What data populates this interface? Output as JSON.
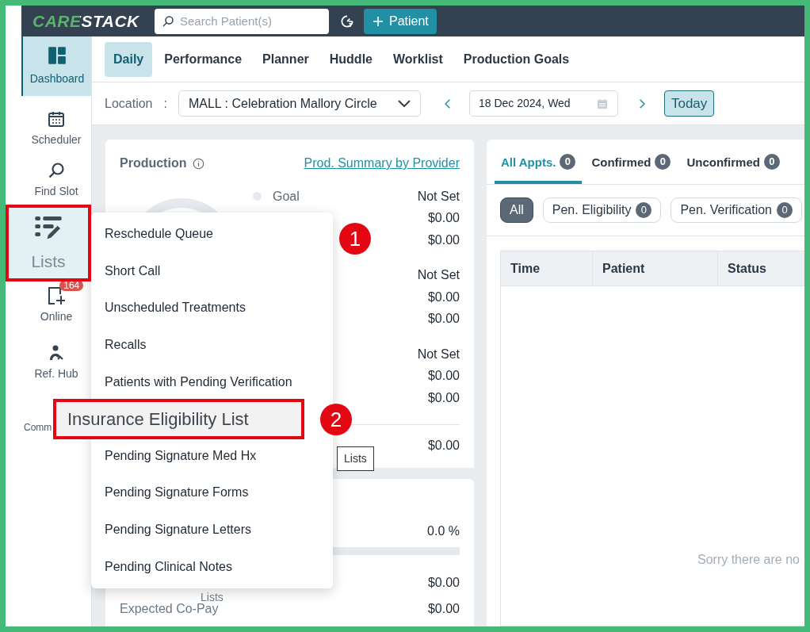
{
  "topbar": {
    "logo": "CARESTACK",
    "search": {
      "placeholder": "Search Patient(s)"
    },
    "add_button": "Patient"
  },
  "sidebar": {
    "items": [
      {
        "kind": "dashboard",
        "label": "Dashboard",
        "selected": true
      },
      {
        "kind": "calendar",
        "label": "Scheduler",
        "selected": false
      },
      {
        "kind": "search",
        "label": "Find Slot",
        "selected": false
      },
      {
        "kind": "lists",
        "label": "Lists",
        "selected": false,
        "callout": true
      },
      {
        "kind": "online",
        "label": "Online",
        "selected": false,
        "badge": "164"
      },
      {
        "kind": "refhub",
        "label": "Ref. Hub",
        "selected": false
      },
      {
        "kind": "comm",
        "label": "Comm",
        "selected": false,
        "clipped": true
      }
    ]
  },
  "tabs": [
    {
      "label": "Daily",
      "selected": true
    },
    {
      "label": "Performance",
      "selected": false
    },
    {
      "label": "Planner",
      "selected": false
    },
    {
      "label": "Huddle",
      "selected": false
    },
    {
      "label": "Worklist",
      "selected": false
    },
    {
      "label": "Production Goals",
      "selected": false
    }
  ],
  "filters": {
    "location_label": "Location",
    "location_sep": ":",
    "location": "MALL : Celebration Mallory Circle",
    "date": "18 Dec 2024, Wed",
    "today": "Today"
  },
  "production": {
    "title": "Production",
    "link": "Prod. Summary by Provider",
    "groups": [
      [
        {
          "label": "Goal",
          "value": "Not Set"
        },
        {
          "value": "$0.00"
        },
        {
          "value": "$0.00"
        }
      ],
      [
        {
          "value": "Not Set"
        },
        {
          "value": "$0.00"
        },
        {
          "value": "$0.00"
        }
      ],
      [
        {
          "value": "Not Set"
        },
        {
          "value": "$0.00"
        },
        {
          "value": "$0.00"
        }
      ]
    ],
    "total": "$0.00"
  },
  "collection": {
    "percent": "0.0 %",
    "level": 0,
    "rows": [
      {
        "value": "$0.00"
      },
      {
        "label": "Expected Co-Pay",
        "value": "$0.00"
      }
    ]
  },
  "menu": {
    "items": [
      {
        "label": "Reschedule Queue",
        "selected": false
      },
      {
        "label": "Short Call",
        "selected": false
      },
      {
        "label": "Unscheduled Treatments",
        "selected": false
      },
      {
        "label": "Recalls",
        "selected": false
      },
      {
        "label": "Patients with Pending Verification",
        "selected": false
      },
      {
        "label": "Insurance Eligibility List",
        "selected": true,
        "callout": true
      },
      {
        "label": "Pending Signature Med Hx",
        "selected": false
      },
      {
        "label": "Pending Signature Forms",
        "selected": false
      },
      {
        "label": "Pending Signature Letters",
        "selected": false
      },
      {
        "label": "Pending Clinical Notes",
        "selected": false
      }
    ]
  },
  "tooltips": [
    "Lists",
    "Lists"
  ],
  "step_markers": [
    "1",
    "2"
  ],
  "appointments": {
    "tabs": [
      {
        "label": "All Appts.",
        "count": "0",
        "selected": true
      },
      {
        "label": "Confirmed",
        "count": "0",
        "selected": false
      },
      {
        "label": "Unconfirmed",
        "count": "0",
        "selected": false
      }
    ],
    "chips": [
      {
        "label": "All",
        "selected": true
      },
      {
        "label": "Pen. Eligibility",
        "count": "0",
        "selected": false
      },
      {
        "label": "Pen. Verification",
        "count": "0",
        "selected": false
      }
    ],
    "columns": [
      "Time",
      "Patient",
      "Status"
    ],
    "empty": "Sorry there are no"
  }
}
